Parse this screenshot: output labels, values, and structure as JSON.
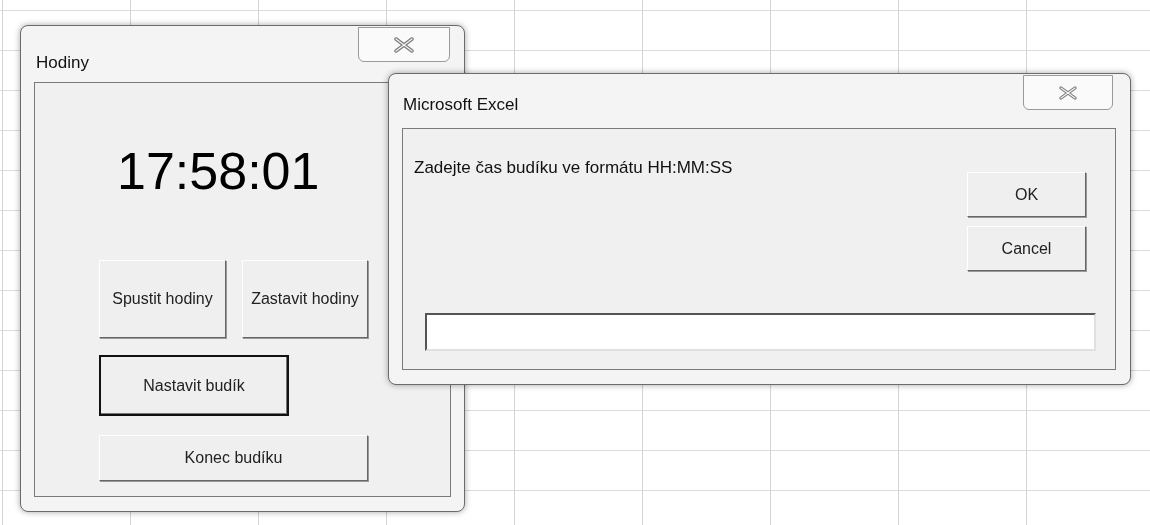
{
  "clock_window": {
    "title": "Hodiny",
    "time": "17:58:01",
    "buttons": [
      {
        "label": "Spustit hodiny",
        "default": false
      },
      {
        "label": "Zastavit hodiny",
        "default": false
      },
      {
        "label": "Nastavit budík",
        "default": true
      },
      {
        "label": "Konec budíku",
        "default": false
      }
    ]
  },
  "input_dialog": {
    "title": "Microsoft Excel",
    "prompt": "Zadejte čas budíku ve formátu HH:MM:SS",
    "buttons": [
      {
        "label": "OK",
        "default": false
      },
      {
        "label": "Cancel",
        "default": false
      }
    ]
  }
}
